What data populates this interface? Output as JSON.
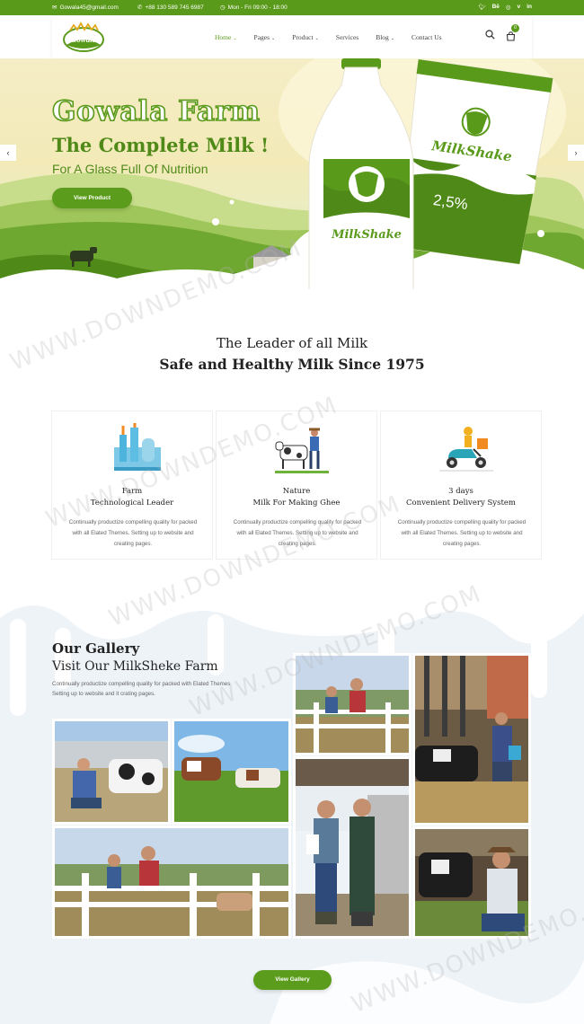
{
  "topbar": {
    "email": "Gowala45@gmail.com",
    "phone": "+88 130 589 745 6987",
    "hours": "Mon - Fri 09:00 - 18:00"
  },
  "brand": {
    "name": "Gowala"
  },
  "nav": {
    "items": [
      {
        "label": "Home",
        "dropdown": true,
        "active": true
      },
      {
        "label": "Pages",
        "dropdown": true
      },
      {
        "label": "Product",
        "dropdown": true
      },
      {
        "label": "Services",
        "dropdown": false
      },
      {
        "label": "Blog",
        "dropdown": true
      },
      {
        "label": "Contact Us",
        "dropdown": false
      }
    ],
    "cart_count": "0"
  },
  "hero": {
    "title": "Gowala Farm",
    "subtitle": "The Complete Milk !",
    "tagline": "For A Glass Full Of Nutrition",
    "button": "View Product",
    "bottle_label": "MilkShake",
    "pack_label": "MilkShake",
    "pack_percent": "2,5%"
  },
  "intro": {
    "line1": "The Leader of all Milk",
    "line2": "Safe and Healthy Milk Since 1975"
  },
  "features": [
    {
      "title1": "Farm",
      "title2": "Technological Leader",
      "desc": "Continually productize compelling quality for packed with all Elated Themes. Setting up to website and creating pages."
    },
    {
      "title1": "Nature",
      "title2": "Milk For Making Ghee",
      "desc": "Continually productize compelling quality for packed with all Elated Themes. Setting up to website and creating pages."
    },
    {
      "title1": "3 days",
      "title2": "Convenient Delivery System",
      "desc": "Continually productize compelling quality for packed with all Elated Themes. Setting up to website and creating pages."
    }
  ],
  "gallery": {
    "title": "Our Gallery",
    "subtitle": "Visit Our MilkSheke Farm",
    "desc": "Continually productize compelling quality for packed with Elated Themes Setting up to website and it crating pages.",
    "button": "View Gallery"
  },
  "watermark": "WWW.DOWNDEMO.COM",
  "colors": {
    "brand_green": "#5a9a1a",
    "dark_green": "#4f8a18"
  },
  "icons": [
    "mail-icon",
    "phone-icon",
    "clock-icon",
    "twitter-icon",
    "behance-icon",
    "instagram-icon",
    "vimeo-icon",
    "linkedin-icon",
    "search-icon",
    "cart-icon",
    "chevron-left-icon",
    "chevron-right-icon"
  ]
}
